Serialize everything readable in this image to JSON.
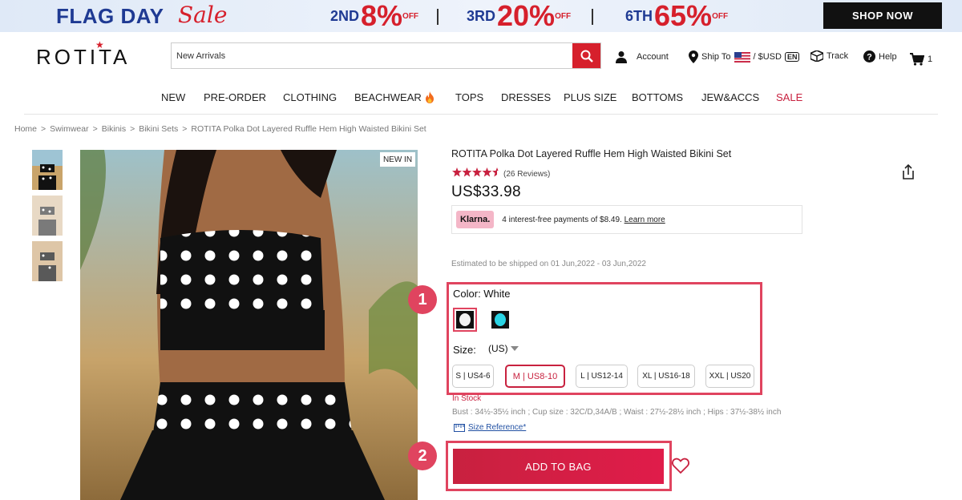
{
  "banner": {
    "flag_day": "FLAG DAY",
    "sale": "Sale",
    "promos": [
      {
        "label": "2ND",
        "pct": "8%",
        "off": "OFF"
      },
      {
        "label": "3RD",
        "pct": "20%",
        "off": "OFF"
      },
      {
        "label": "6TH",
        "pct": "65%",
        "off": "OFF"
      }
    ],
    "shop_now": "SHOP NOW"
  },
  "header": {
    "logo": "ROTITA",
    "search_value": "New Arrivals",
    "account": "Account",
    "ship_to": "Ship To",
    "currency": "/ $USD",
    "lang": "EN",
    "track": "Track",
    "help": "Help",
    "cart_count": "1"
  },
  "nav": [
    "NEW",
    "PRE-ORDER",
    "CLOTHING",
    "BEACHWEAR",
    "TOPS",
    "DRESSES",
    "PLUS SIZE",
    "BOTTOMS",
    "JEW&ACCS",
    "SALE"
  ],
  "breadcrumb": [
    "Home",
    ">",
    "Swimwear",
    ">",
    "Bikinis",
    ">",
    "Bikini Sets",
    ">",
    "ROTITA Polka Dot Layered Ruffle Hem High Waisted Bikini Set"
  ],
  "gallery": {
    "badge": "NEW IN"
  },
  "product": {
    "title": "ROTITA Polka Dot Layered Ruffle Hem High Waisted Bikini Set",
    "rating": 4.5,
    "reviews": "(26 Reviews)",
    "price": "US$33.98",
    "klarna_logo": "Klarna.",
    "klarna_text": "4 interest-free payments of $8.49.",
    "klarna_link": "Learn more",
    "shipping": "Estimated to be shipped on 01 Jun,2022 - 03 Jun,2022",
    "color_label": "Color: White",
    "size_label": "Size:",
    "size_unit": "(US)",
    "sizes": [
      "S | US4-6",
      "M | US8-10",
      "L | US12-14",
      "XL | US16-18",
      "XXL | US20"
    ],
    "selected_size": "M | US8-10",
    "stock": "In Stock",
    "measurements": "Bust : 34½-35½ inch ; Cup size : 32C/D,34A/B ; Waist : 27½-28½ inch ; Hips : 37½-38½ inch",
    "size_reference": "Size Reference*",
    "add_to_bag": "ADD TO BAG"
  },
  "annotations": [
    "1",
    "2"
  ],
  "colors": {
    "accent": "#d6202c",
    "brand_red": "#c8213f",
    "highlight": "#e0445f",
    "navy": "#1f3a93"
  }
}
